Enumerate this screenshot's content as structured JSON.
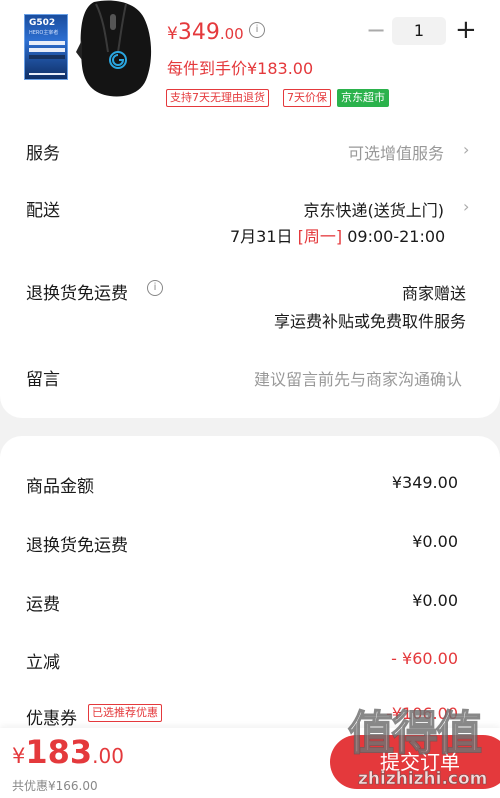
{
  "product": {
    "box_title": "G502",
    "box_sub": "HERO主宰者",
    "price_yen": "¥",
    "price_int": "349",
    "price_dec": ".00",
    "quantity": "1",
    "hand_price": "每件到手价¥183.00",
    "tags": [
      "支持7天无理由退货",
      "7天价保",
      "京东超市"
    ]
  },
  "rows": {
    "service_label": "服务",
    "service_value": "可选增值服务",
    "delivery_label": "配送",
    "delivery_value": "京东快递(送货上门)",
    "delivery_date": "7月31日",
    "delivery_weekday": "[周一]",
    "delivery_time": "09:00-21:00",
    "return_label": "退换货免运费",
    "return_value": "商家赠送",
    "return_sub": "享运费补贴或免费取件服务",
    "message_label": "留言",
    "message_placeholder": "建议留言前先与商家沟通确认"
  },
  "summary": [
    {
      "label": "商品金额",
      "value": "¥349.00",
      "color": "#1a1a1a"
    },
    {
      "label": "退换货免运费",
      "value": "¥0.00",
      "color": "#1a1a1a"
    },
    {
      "label": "运费",
      "value": "¥0.00",
      "color": "#1a1a1a"
    },
    {
      "label": "立减",
      "value": "- ¥60.00",
      "color": "#e4393c"
    },
    {
      "label": "优惠券",
      "value": "-¥106.00",
      "color": "#e4393c"
    }
  ],
  "coupon_tag": "已选推荐优惠",
  "bottom": {
    "total_yen": "¥",
    "total_int": "183",
    "total_dec": ".00",
    "saved": "共优惠¥166.00",
    "submit": "提交订单"
  },
  "watermark": {
    "big": "值得值",
    "small": "zhizhizhi.com"
  },
  "colors": {
    "accent": "#e4393c",
    "green": "#2bb24c"
  }
}
